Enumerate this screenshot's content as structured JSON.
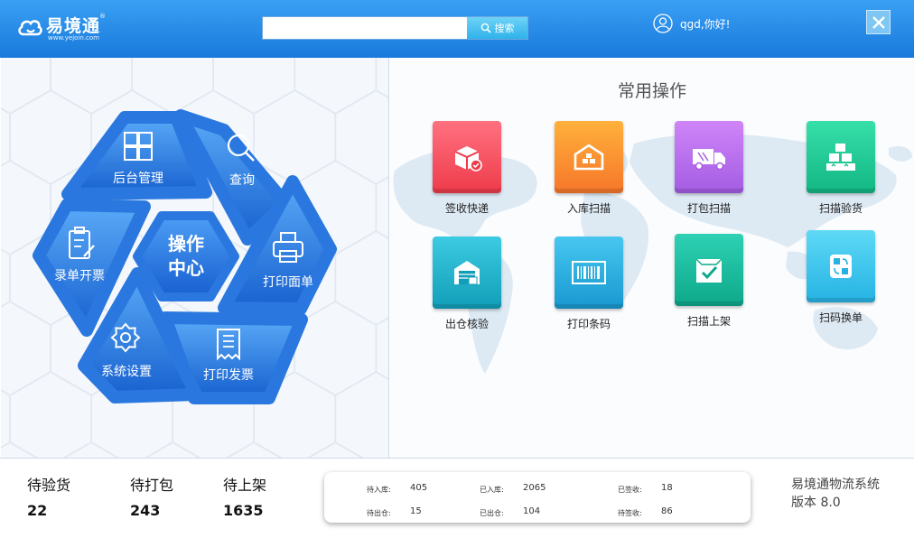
{
  "header": {
    "brand": "易境通",
    "brand_mark": "®",
    "url": "www.yejoin.com",
    "search_placeholder": "",
    "search_button": "搜索",
    "greeting": "qgd,你好!",
    "close_icon": "close-icon"
  },
  "hub": {
    "center_line1": "操作",
    "center_line2": "中心",
    "segments": [
      {
        "id": "backend",
        "label": "后台管理",
        "icon": "grid-icon"
      },
      {
        "id": "query",
        "label": "查询",
        "icon": "search-icon"
      },
      {
        "id": "print-sheet",
        "label": "打印面单",
        "icon": "printer-icon"
      },
      {
        "id": "print-invoice",
        "label": "打印发票",
        "icon": "receipt-icon"
      },
      {
        "id": "settings",
        "label": "系统设置",
        "icon": "gear-icon"
      },
      {
        "id": "entry",
        "label": "录单开票",
        "icon": "clipboard-icon"
      }
    ]
  },
  "operations": {
    "title": "常用操作",
    "items": [
      {
        "label": "签收快递",
        "icon": "package-sign-icon",
        "color": "#f2535f"
      },
      {
        "label": "入库扫描",
        "icon": "warehouse-in-icon",
        "color": "#fb8a2a"
      },
      {
        "label": "打包扫描",
        "icon": "truck-icon",
        "color": "#b66ae8"
      },
      {
        "label": "扫描验货",
        "icon": "stacked-boxes-icon",
        "color": "#1fcc93"
      },
      {
        "label": "出仓核验",
        "icon": "warehouse-out-icon",
        "color": "#1ab2cc"
      },
      {
        "label": "打印条码",
        "icon": "barcode-icon",
        "color": "#22b4de"
      },
      {
        "label": "扫描上架",
        "icon": "box-check-icon",
        "color": "#1bbf9f"
      },
      {
        "label": "扫码换单",
        "icon": "swap-label-icon",
        "color": "#2ac0ea"
      }
    ]
  },
  "pending": [
    {
      "label": "待验货",
      "value": "22"
    },
    {
      "label": "待打包",
      "value": "243"
    },
    {
      "label": "待上架",
      "value": "1635"
    }
  ],
  "stats": [
    {
      "label": "待入库:",
      "value": "405"
    },
    {
      "label": "已入库:",
      "value": "2065"
    },
    {
      "label": "已签收:",
      "value": "18"
    },
    {
      "label": "待出仓:",
      "value": "15"
    },
    {
      "label": "已出仓:",
      "value": "104"
    },
    {
      "label": "待签收:",
      "value": "86"
    }
  ],
  "system": {
    "name": "易境通物流系统",
    "version": "版本 8.0"
  }
}
